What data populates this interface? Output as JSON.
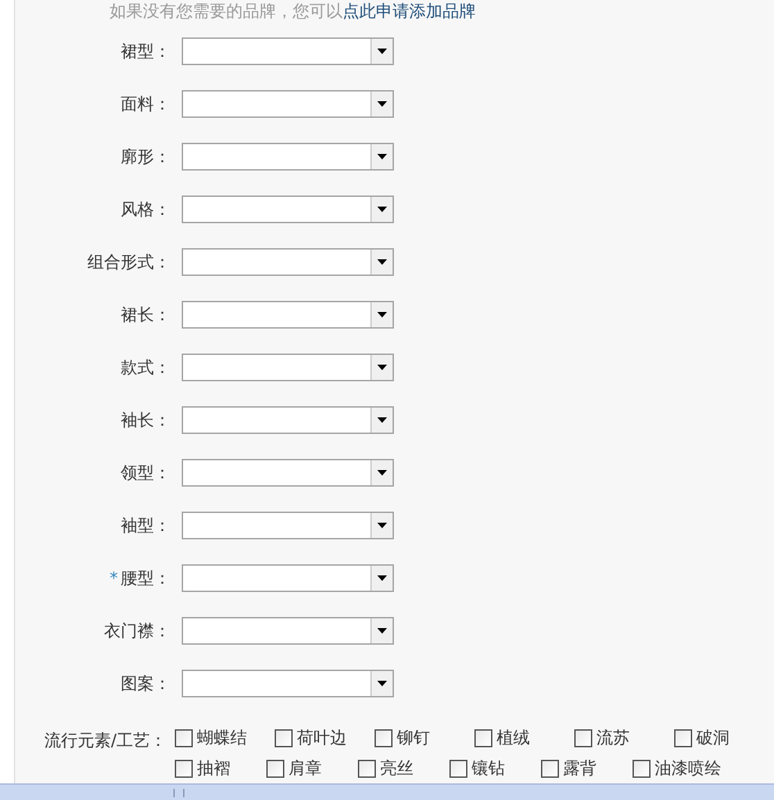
{
  "hint": {
    "text": "如果没有您需要的品牌，您可以",
    "link": "点此申请添加品牌"
  },
  "fields": [
    {
      "label": "裙型：",
      "required": false
    },
    {
      "label": "面料：",
      "required": false
    },
    {
      "label": "廓形：",
      "required": false
    },
    {
      "label": "风格：",
      "required": false
    },
    {
      "label": "组合形式：",
      "required": false
    },
    {
      "label": "裙长：",
      "required": false
    },
    {
      "label": "款式：",
      "required": false
    },
    {
      "label": "袖长：",
      "required": false
    },
    {
      "label": "领型：",
      "required": false
    },
    {
      "label": "袖型：",
      "required": false
    },
    {
      "label": "腰型：",
      "required": true
    },
    {
      "label": "衣门襟：",
      "required": false
    },
    {
      "label": "图案：",
      "required": false
    }
  ],
  "required_mark": "*",
  "trends": {
    "label": "流行元素/工艺：",
    "options": [
      {
        "label": "蝴蝶结",
        "checked": false
      },
      {
        "label": "荷叶边",
        "checked": false
      },
      {
        "label": "铆钉",
        "checked": false
      },
      {
        "label": "植绒",
        "checked": false
      },
      {
        "label": "流苏",
        "checked": false
      },
      {
        "label": "破洞",
        "checked": false
      },
      {
        "label": "抽褶",
        "checked": false
      },
      {
        "label": "肩章",
        "checked": false
      },
      {
        "label": "亮丝",
        "checked": false
      },
      {
        "label": "镶钻",
        "checked": false
      },
      {
        "label": "露背",
        "checked": false
      },
      {
        "label": "油漆喷绘",
        "checked": false
      }
    ]
  }
}
